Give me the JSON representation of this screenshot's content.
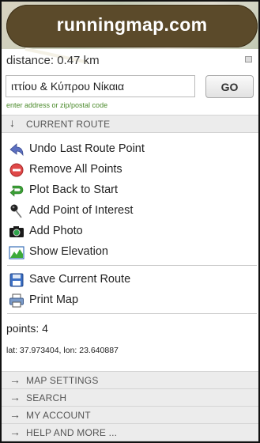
{
  "header": {
    "logo_text": "runningmap.com"
  },
  "distance": {
    "label": "distance: 0.47 km"
  },
  "address": {
    "value": "ιττίου & Κύπρου Νίκαια",
    "go_label": "GO",
    "hint": "enter address or zip/postal code"
  },
  "current_route": {
    "title": "CURRENT ROUTE",
    "items": [
      {
        "label": "Undo Last Route Point",
        "icon": "undo-arrow-icon"
      },
      {
        "label": "Remove All Points",
        "icon": "remove-circle-icon"
      },
      {
        "label": "Plot Back to Start",
        "icon": "return-arrow-icon"
      },
      {
        "label": "Add Point of Interest",
        "icon": "pushpin-icon"
      },
      {
        "label": "Add Photo",
        "icon": "camera-icon"
      },
      {
        "label": "Show Elevation",
        "icon": "elevation-chart-icon"
      },
      {
        "label": "Save Current Route",
        "icon": "floppy-disk-icon"
      },
      {
        "label": "Print Map",
        "icon": "printer-icon"
      }
    ],
    "points": "points: 4",
    "latlon": "lat: 37.973404, lon: 23.640887"
  },
  "sections": [
    {
      "label": "MAP SETTINGS"
    },
    {
      "label": "SEARCH"
    },
    {
      "label": "MY ACCOUNT"
    },
    {
      "label": "HELP AND MORE ..."
    }
  ],
  "colors": {
    "logo_bg": "#5b4a2a",
    "hint": "#4a8a2a",
    "section_bg": "#ececec"
  }
}
